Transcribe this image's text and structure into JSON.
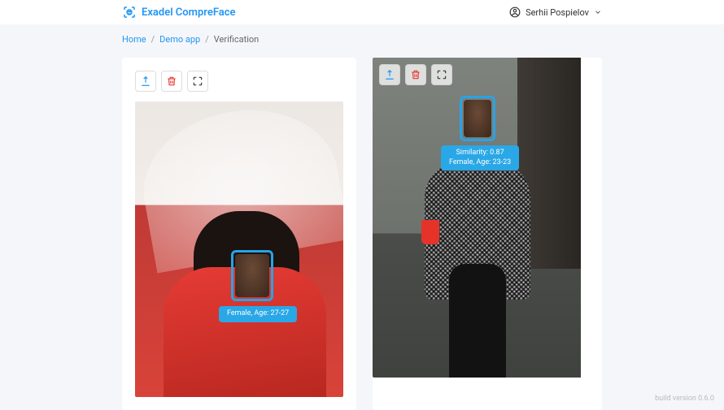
{
  "brand": {
    "name": "Exadel CompreFace"
  },
  "user": {
    "name": "Serhii Pospielov"
  },
  "breadcrumb": {
    "items": [
      {
        "label": "Home",
        "link": true
      },
      {
        "label": "Demo app",
        "link": true
      },
      {
        "label": "Verification",
        "link": false
      }
    ],
    "separator": "/"
  },
  "icons": {
    "upload": "upload-icon",
    "delete": "trash-icon",
    "fullscreen": "expand-icon"
  },
  "left_panel": {
    "detection": {
      "label": "Female, Age: 27-27"
    }
  },
  "right_panel": {
    "detection": {
      "similarity_label": "Similarity: 0.87",
      "demographics_label": "Female, Age: 23-23"
    }
  },
  "footer": {
    "version": "build version 0.6.0"
  },
  "colors": {
    "accent": "#2196f3",
    "detection_box": "#29a3e6",
    "badge": "#2aa7e6"
  }
}
